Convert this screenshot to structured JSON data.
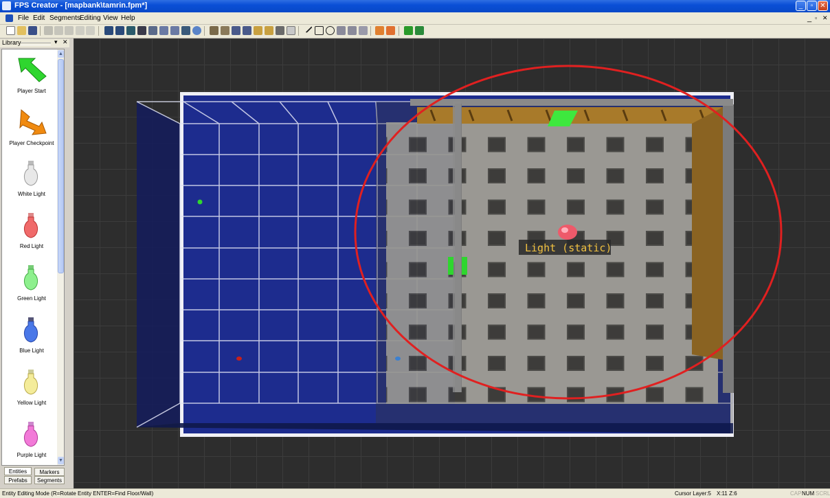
{
  "window": {
    "title": "FPS Creator - [mapbank\\tamrin.fpm*]"
  },
  "menu": [
    "File",
    "Edit",
    "Segments",
    "Editing",
    "View",
    "Help"
  ],
  "library": {
    "title": "Library",
    "items": [
      {
        "label": "Player Start",
        "icon": "green-arrow-icon",
        "color": "#2fd62f"
      },
      {
        "label": "Player Checkpoint",
        "icon": "orange-arrow-icon",
        "color": "#f08a10"
      },
      {
        "label": "White Light",
        "icon": "light-bulb-icon",
        "color": "#e8e8e8"
      },
      {
        "label": "Red Light",
        "icon": "light-bulb-icon",
        "color": "#f06a6a"
      },
      {
        "label": "Green Light",
        "icon": "light-bulb-icon",
        "color": "#8ef08e"
      },
      {
        "label": "Blue Light",
        "icon": "light-bulb-icon",
        "color": "#4a78e8"
      },
      {
        "label": "Yellow Light",
        "icon": "light-bulb-icon",
        "color": "#f4ec9a"
      },
      {
        "label": "Purple Light",
        "icon": "light-bulb-icon",
        "color": "#f27ad8"
      }
    ],
    "tabs": [
      "Entities",
      "Markers",
      "Prefabs",
      "Segments"
    ]
  },
  "viewport": {
    "tooltip": "Light (static)"
  },
  "status": {
    "mode": "Entity Editing Mode (R=Rotate Entity  ENTER=Find Floor/Wall)",
    "cursor_layer": "Cursor Layer:5",
    "coords": "X:11  Z:6",
    "cap": "CAP",
    "num": "NUM",
    "scrl": "SCRL"
  }
}
